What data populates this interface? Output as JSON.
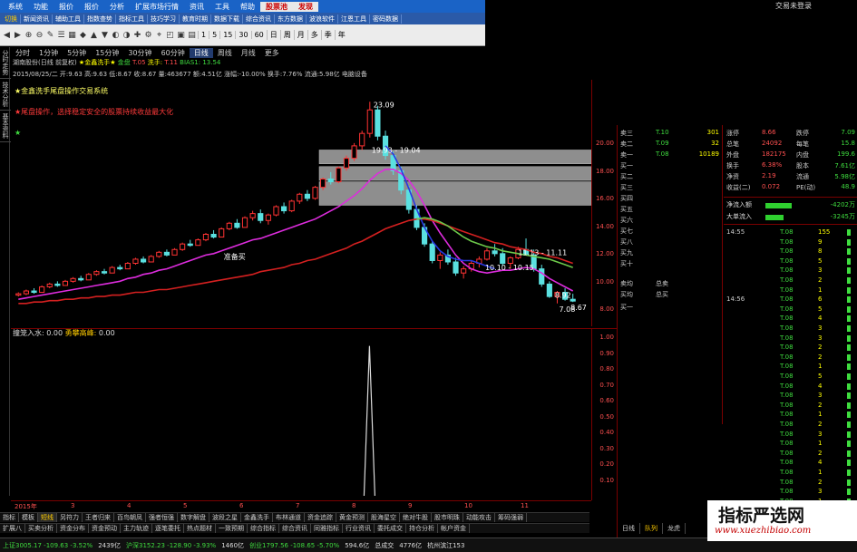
{
  "menu": {
    "items": [
      "系统",
      "功能",
      "报价",
      "报价",
      "分析",
      "扩展市场行情",
      "资讯",
      "工具",
      "帮助",
      "股票池",
      "发现"
    ],
    "right_text": "交易未登录"
  },
  "nav": {
    "items": [
      "切换",
      "新闻资讯",
      "辅助工具",
      "指数查势",
      "指标工具",
      "技巧学习",
      "教育时期",
      "数据下载",
      "综合资讯",
      "东方数据",
      "波浪软件",
      "江恩工具",
      "密码数据"
    ]
  },
  "toolbar": {
    "icons": [
      "◀",
      "▶",
      "⊕",
      "⊖",
      "✎",
      "☰",
      "▦",
      "◆",
      "▲",
      "▼",
      "◐",
      "◑",
      "✚",
      "⚙",
      "⌖",
      "◰",
      "▣",
      "▤"
    ],
    "periods": [
      "1",
      "5",
      "15",
      "30",
      "60",
      "日",
      "周",
      "月",
      "多",
      "季",
      "年"
    ]
  },
  "sidebar": {
    "items": [
      "分时走势",
      "技术分析",
      "基本资料"
    ]
  },
  "periods": {
    "items": [
      "分时",
      "1分钟",
      "5分钟",
      "15分钟",
      "30分钟",
      "60分钟",
      "日线",
      "周线",
      "月线",
      "更多"
    ],
    "active_index": 6
  },
  "info": {
    "stock": "湖南股份(日线 前复权)",
    "indicator": "★金鑫洗手★",
    "gold_label": "金盘",
    "gold_value": "T.05",
    "up_label": "洗手:",
    "up_value": "T.11",
    "bias_label": "BIAS1:",
    "bias_value": "13.54",
    "date_line": "2015/08/25/二 开:9.63 高:9.63 低:8.67 收:8.67 量:463677 额:4.51亿 涨幅:-10.00% 换手:7.76% 流通:5.98亿 电脑设备"
  },
  "legends": {
    "l1": "★金鑫洗手尾盘操作交易系统",
    "l2": "★尾盘操作，选择稳定安全的股票持续收益最大化",
    "l3": "★"
  },
  "chart_annotations": {
    "peak": "23.09",
    "range1": "19.93 - 19.04",
    "buy": "准备买",
    "range2": "10.10 - 10.15",
    "range3": "11.13 - 11.11",
    "low1": "8.92",
    "low2": "7.08",
    "low3": "8.67"
  },
  "chart_data": {
    "type": "candlestick",
    "ylim": [
      7.5,
      23.5
    ],
    "y_ticks": [
      "20.00",
      "18.00",
      "16.00",
      "14.00",
      "12.00",
      "10.00",
      "8.00"
    ],
    "candles": [
      [
        9.1,
        9.3,
        9.0,
        9.2
      ],
      [
        9.2,
        9.5,
        9.1,
        9.4
      ],
      [
        9.4,
        9.6,
        9.2,
        9.3
      ],
      [
        9.3,
        9.8,
        9.3,
        9.7
      ],
      [
        9.7,
        10.0,
        9.6,
        9.9
      ],
      [
        9.9,
        10.1,
        9.7,
        9.8
      ],
      [
        9.8,
        10.2,
        9.8,
        10.1
      ],
      [
        10.1,
        10.4,
        10.0,
        10.3
      ],
      [
        10.3,
        10.5,
        10.1,
        10.2
      ],
      [
        10.2,
        10.7,
        10.2,
        10.6
      ],
      [
        10.6,
        10.9,
        10.5,
        10.8
      ],
      [
        10.8,
        11.0,
        10.6,
        10.7
      ],
      [
        10.7,
        11.2,
        10.7,
        11.1
      ],
      [
        11.1,
        11.3,
        10.9,
        11.0
      ],
      [
        11.0,
        11.5,
        11.0,
        11.4
      ],
      [
        11.4,
        11.8,
        11.3,
        11.7
      ],
      [
        11.7,
        11.9,
        11.4,
        11.5
      ],
      [
        11.5,
        12.0,
        11.5,
        11.9
      ],
      [
        11.9,
        12.3,
        11.8,
        12.2
      ],
      [
        12.2,
        12.4,
        11.9,
        12.0
      ],
      [
        12.0,
        12.5,
        12.0,
        12.4
      ],
      [
        12.4,
        12.9,
        12.3,
        12.8
      ],
      [
        12.8,
        13.1,
        12.6,
        12.7
      ],
      [
        12.7,
        13.2,
        12.7,
        13.1
      ],
      [
        13.1,
        13.6,
        13.0,
        13.5
      ],
      [
        13.5,
        13.8,
        13.2,
        13.3
      ],
      [
        13.3,
        14.0,
        13.3,
        13.9
      ],
      [
        13.9,
        14.4,
        13.8,
        14.3
      ],
      [
        14.3,
        14.6,
        13.9,
        14.0
      ],
      [
        14.0,
        14.8,
        14.0,
        14.7
      ],
      [
        14.7,
        15.2,
        14.5,
        15.0
      ],
      [
        15.0,
        15.3,
        14.3,
        14.5
      ],
      [
        14.5,
        15.0,
        14.2,
        14.9
      ],
      [
        14.9,
        15.6,
        14.8,
        15.5
      ],
      [
        15.5,
        15.8,
        15.0,
        15.2
      ],
      [
        15.2,
        16.0,
        15.1,
        15.9
      ],
      [
        15.9,
        16.5,
        15.7,
        16.4
      ],
      [
        16.4,
        16.7,
        15.9,
        16.1
      ],
      [
        16.1,
        17.0,
        16.0,
        16.9
      ],
      [
        16.9,
        17.6,
        16.7,
        17.5
      ],
      [
        17.5,
        18.0,
        17.1,
        17.3
      ],
      [
        17.3,
        18.4,
        17.2,
        18.3
      ],
      [
        18.3,
        19.2,
        18.1,
        19.0
      ],
      [
        19.0,
        20.1,
        18.8,
        19.9
      ],
      [
        19.9,
        21.0,
        19.6,
        20.8
      ],
      [
        20.8,
        23.09,
        20.5,
        22.5
      ],
      [
        22.5,
        22.8,
        20.3,
        20.6
      ],
      [
        20.6,
        21.0,
        18.9,
        19.2
      ],
      [
        19.2,
        19.5,
        17.8,
        18.1
      ],
      [
        18.1,
        18.4,
        16.4,
        16.7
      ],
      [
        16.7,
        17.0,
        15.0,
        15.3
      ],
      [
        15.3,
        15.6,
        13.8,
        14.0
      ],
      [
        14.0,
        14.3,
        12.6,
        12.8
      ],
      [
        12.8,
        13.0,
        11.4,
        11.6
      ],
      [
        11.6,
        12.2,
        11.0,
        12.0
      ],
      [
        12.0,
        12.4,
        11.3,
        11.5
      ],
      [
        11.5,
        11.8,
        10.5,
        10.7
      ],
      [
        10.7,
        11.2,
        10.3,
        11.0
      ],
      [
        11.0,
        11.6,
        10.8,
        11.4
      ],
      [
        11.4,
        11.9,
        11.1,
        11.7
      ],
      [
        11.7,
        12.5,
        11.6,
        12.3
      ],
      [
        12.3,
        12.8,
        11.9,
        12.1
      ],
      [
        12.1,
        12.5,
        11.2,
        11.4
      ],
      [
        11.4,
        11.9,
        11.0,
        11.8
      ],
      [
        11.8,
        12.6,
        11.7,
        12.4
      ],
      [
        12.4,
        13.2,
        12.2,
        12.0
      ],
      [
        12.0,
        12.4,
        10.8,
        11.0
      ],
      [
        11.0,
        11.3,
        9.7,
        9.9
      ],
      [
        9.9,
        10.1,
        8.9,
        9.0
      ],
      [
        9.0,
        9.4,
        8.5,
        9.3
      ],
      [
        9.3,
        9.6,
        8.7,
        8.8
      ],
      [
        8.8,
        9.2,
        8.6,
        8.67
      ]
    ],
    "series": [
      {
        "name": "MA短",
        "color": "#dd2cdd",
        "values": [
          8.8,
          8.9,
          9.0,
          9.1,
          9.2,
          9.3,
          9.4,
          9.5,
          9.6,
          9.7,
          9.8,
          9.9,
          10.0,
          10.1,
          10.3,
          10.4,
          10.6,
          10.7,
          10.9,
          11.0,
          11.2,
          11.4,
          11.6,
          11.8,
          12.0,
          12.1,
          12.3,
          12.5,
          12.7,
          12.9,
          13.1,
          13.2,
          13.4,
          13.6,
          13.8,
          14.0,
          14.2,
          14.4,
          14.6,
          14.9,
          15.2,
          15.5,
          15.9,
          16.3,
          16.8,
          17.4,
          17.9,
          18.2,
          18.2,
          17.9,
          17.4,
          16.6,
          15.6,
          14.5,
          13.6,
          12.8,
          12.0,
          11.4,
          11.0,
          10.8,
          10.7,
          10.8,
          10.9,
          10.9,
          11.0,
          11.1,
          11.0,
          10.7,
          10.3,
          10.0,
          9.7,
          9.4
        ]
      },
      {
        "name": "MA长",
        "color": "#d42020",
        "values": [
          8.5,
          8.5,
          8.6,
          8.6,
          8.7,
          8.7,
          8.8,
          8.8,
          8.9,
          8.9,
          9.0,
          9.0,
          9.1,
          9.1,
          9.2,
          9.3,
          9.3,
          9.4,
          9.5,
          9.5,
          9.6,
          9.7,
          9.8,
          9.9,
          10.0,
          10.1,
          10.2,
          10.3,
          10.4,
          10.5,
          10.6,
          10.8,
          10.9,
          11.0,
          11.1,
          11.3,
          11.4,
          11.6,
          11.7,
          11.9,
          12.1,
          12.3,
          12.5,
          12.8,
          13.0,
          13.3,
          13.6,
          13.9,
          14.1,
          14.3,
          14.5,
          14.6,
          14.6,
          14.5,
          14.3,
          14.1,
          13.9,
          13.7,
          13.5,
          13.3,
          13.1,
          12.9,
          12.8,
          12.6,
          12.5,
          12.4,
          12.2,
          12.1,
          11.9,
          11.8,
          11.6,
          11.4
        ]
      },
      {
        "name": "下降线",
        "color": "#2838e0",
        "values": [
          null,
          null,
          null,
          null,
          null,
          null,
          null,
          null,
          null,
          null,
          null,
          null,
          null,
          null,
          null,
          null,
          null,
          null,
          null,
          null,
          null,
          null,
          null,
          null,
          null,
          null,
          null,
          null,
          null,
          null,
          null,
          null,
          null,
          null,
          null,
          null,
          null,
          null,
          null,
          null,
          null,
          null,
          null,
          null,
          null,
          null,
          null,
          19.9,
          19.3,
          18.2,
          16.8,
          15.3,
          14.0,
          13.0,
          12.3,
          11.9,
          11.7,
          11.6,
          11.6,
          11.4,
          11.2,
          11.0,
          null,
          null,
          null,
          null,
          null,
          null,
          null,
          null,
          null,
          null
        ]
      },
      {
        "name": "绿线",
        "color": "#6cc84a",
        "values": [
          null,
          null,
          null,
          null,
          null,
          null,
          null,
          null,
          null,
          null,
          null,
          null,
          null,
          null,
          null,
          null,
          null,
          null,
          null,
          null,
          null,
          null,
          null,
          null,
          null,
          null,
          null,
          null,
          null,
          null,
          null,
          null,
          null,
          null,
          null,
          null,
          null,
          null,
          null,
          null,
          null,
          null,
          null,
          null,
          null,
          null,
          null,
          null,
          null,
          null,
          null,
          14.6,
          14.7,
          14.6,
          14.4,
          14.1,
          13.7,
          13.3,
          13.0,
          12.8,
          12.6,
          12.5,
          12.3,
          12.2,
          12.1,
          12.0,
          11.9,
          11.8,
          11.7,
          11.5,
          11.3,
          11.1
        ]
      }
    ],
    "gray_bands": [
      [
        18.6,
        19.6
      ],
      [
        17.4,
        18.4
      ],
      [
        15.6,
        17.3
      ]
    ]
  },
  "indicator_panel": {
    "title": "撞笼入水",
    "value_label": "撞笼入水:",
    "value": "0.00",
    "label2": "勇攀高峰:",
    "value2": "0.00",
    "y_ticks": [
      "1.00",
      "0.90",
      "0.80",
      "0.70",
      "0.60",
      "0.50",
      "0.40",
      "0.30",
      "0.20",
      "0.10"
    ],
    "spike_index": 45,
    "spike_value": 0.95
  },
  "date_axis": [
    "2015年",
    "3",
    "4",
    "5",
    "6",
    "7",
    "8",
    "9",
    "10",
    "11"
  ],
  "tabs_row1": [
    "指标",
    "模板",
    "短线",
    "另符力",
    "王者归来",
    "百鸟朝凤",
    "强者恒强",
    "数字解盘",
    "波段之星",
    "金鑫洗手",
    "布林通道",
    "资金追踪",
    "黄金预测",
    "股海星空",
    "绝对牛股",
    "股市明珠",
    "动能攻击",
    "筹码强弱"
  ],
  "tabs_row2": [
    "扩展八",
    "买卖分析",
    "资金分布",
    "资金预动",
    "主力轨迹",
    "逐笔委托",
    "热点题材",
    "一致预期",
    "综合指标",
    "综合资讯",
    "同雅指标",
    "行业资讯",
    "委托成交",
    "持仓分析",
    "帐户资金"
  ],
  "right_panel": {
    "orderbook": [
      {
        "l": "卖三",
        "p": "T.10",
        "v": "301"
      },
      {
        "l": "卖二",
        "p": "T.09",
        "v": "32"
      },
      {
        "l": "卖一",
        "p": "T.08",
        "v": "10189"
      },
      {
        "l": "买一",
        "p": "",
        "v": ""
      },
      {
        "l": "买二",
        "p": "",
        "v": ""
      },
      {
        "l": "买三",
        "p": "",
        "v": ""
      },
      {
        "l": "买四",
        "p": "",
        "v": ""
      },
      {
        "l": "买五",
        "p": "",
        "v": ""
      },
      {
        "l": "买六",
        "p": "",
        "v": ""
      },
      {
        "l": "买七",
        "p": "",
        "v": ""
      },
      {
        "l": "买八",
        "p": "",
        "v": ""
      },
      {
        "l": "买九",
        "p": "",
        "v": ""
      },
      {
        "l": "买十",
        "p": "",
        "v": ""
      }
    ],
    "ob_mid": {
      "sell_avg": "卖均",
      "sell_total": "总卖",
      "buy_avg": "买均",
      "buy_total": "总买",
      "buy1": "买一"
    },
    "stats": [
      {
        "a": "涨停",
        "b": "8.66",
        "c": "跌停",
        "d": "7.09"
      },
      {
        "a": "总笔",
        "b": "24092",
        "c": "每笔",
        "d": "15.8"
      },
      {
        "a": "外盘",
        "b": "182175",
        "c": "内盘",
        "d": "199.6"
      },
      {
        "a": "换手",
        "b": "6.38%",
        "c": "股本",
        "d": "7.61亿"
      },
      {
        "a": "净资",
        "b": "2.19",
        "c": "流通",
        "d": "5.98亿"
      },
      {
        "a": "收益(二)",
        "b": "0.072",
        "c": "PE(动)",
        "d": "48.9"
      }
    ],
    "flow": [
      {
        "a": "净流入额",
        "w": 58,
        "v": "-4202万"
      },
      {
        "a": "大单流入",
        "w": 40,
        "v": "-3245万"
      }
    ],
    "ticks": [
      {
        "t": "14:55",
        "p": "T.08",
        "v": "155"
      },
      {
        "t": "",
        "p": "T.08",
        "v": "9"
      },
      {
        "t": "",
        "p": "T.08",
        "v": "8"
      },
      {
        "t": "",
        "p": "T.08",
        "v": "5"
      },
      {
        "t": "",
        "p": "T.08",
        "v": "3"
      },
      {
        "t": "",
        "p": "T.08",
        "v": "2"
      },
      {
        "t": "",
        "p": "T.08",
        "v": "1"
      },
      {
        "t": "14:56",
        "p": "T.08",
        "v": "6"
      },
      {
        "t": "",
        "p": "T.08",
        "v": "5"
      },
      {
        "t": "",
        "p": "T.08",
        "v": "4"
      },
      {
        "t": "",
        "p": "T.08",
        "v": "3"
      },
      {
        "t": "",
        "p": "T.08",
        "v": "3"
      },
      {
        "t": "",
        "p": "T.08",
        "v": "2"
      },
      {
        "t": "",
        "p": "T.08",
        "v": "2"
      },
      {
        "t": "",
        "p": "T.08",
        "v": "1"
      },
      {
        "t": "",
        "p": "T.08",
        "v": "5"
      },
      {
        "t": "",
        "p": "T.08",
        "v": "4"
      },
      {
        "t": "",
        "p": "T.08",
        "v": "3"
      },
      {
        "t": "",
        "p": "T.08",
        "v": "2"
      },
      {
        "t": "",
        "p": "T.08",
        "v": "1"
      },
      {
        "t": "",
        "p": "T.08",
        "v": "2"
      },
      {
        "t": "",
        "p": "T.08",
        "v": "3"
      },
      {
        "t": "",
        "p": "T.08",
        "v": "1"
      },
      {
        "t": "",
        "p": "T.08",
        "v": "2"
      },
      {
        "t": "",
        "p": "T.08",
        "v": "4"
      },
      {
        "t": "",
        "p": "T.08",
        "v": "1"
      },
      {
        "t": "",
        "p": "T.08",
        "v": "2"
      },
      {
        "t": "",
        "p": "T.08",
        "v": "3"
      },
      {
        "t": "",
        "p": "T.08",
        "v": "1"
      },
      {
        "t": "",
        "p": "T.08",
        "v": "2"
      }
    ],
    "tabs": [
      "日线",
      "队列",
      "龙虎"
    ],
    "tabs_active": 1
  },
  "status": {
    "items": [
      {
        "t": "上证3005.17 -109.63 -3.52%",
        "c": "gr"
      },
      {
        "t": "2439亿",
        "c": "wt"
      },
      {
        "t": "沪深3152.23 -128.90 -3.93%",
        "c": "gr"
      },
      {
        "t": "1460亿",
        "c": "wt"
      },
      {
        "t": "创业1797.56 -108.65 -5.70%",
        "c": "gr"
      },
      {
        "t": "594.6亿",
        "c": "wt"
      },
      {
        "t": "总成交",
        "c": "wt"
      },
      {
        "t": "4776亿",
        "c": "wt"
      },
      {
        "t": "杭州滨江153",
        "c": "wt"
      }
    ]
  },
  "watermark": {
    "cn": "指标严选网",
    "url": "www.xuezhibiao.com"
  }
}
